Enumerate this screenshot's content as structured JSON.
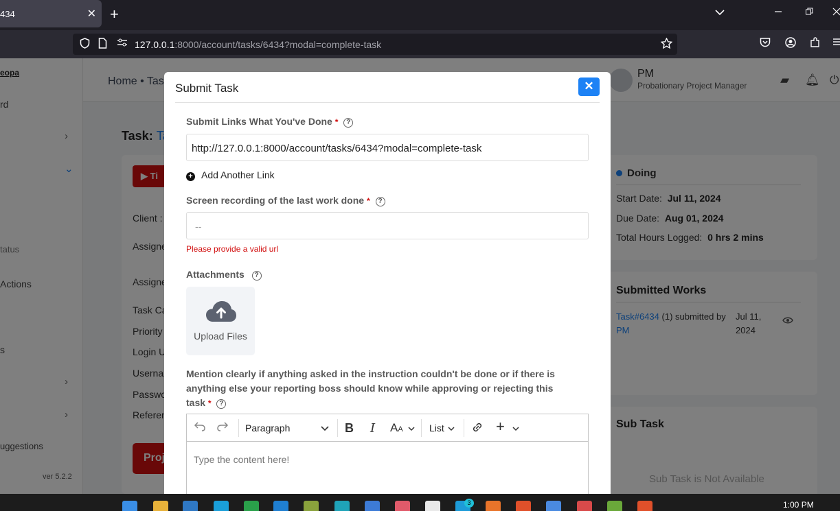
{
  "browser": {
    "tab_title": "434",
    "tab_close": "✕",
    "new_tab": "+",
    "url_host": "127.0.0.1",
    "url_rest": ":8000/account/tasks/6434?modal=complete-task"
  },
  "page": {
    "logo": "eopa",
    "sidebar": {
      "items": [
        {
          "label": "rd"
        },
        {
          "label": "tatus"
        },
        {
          "label": "Actions"
        },
        {
          "label": "s"
        },
        {
          "label": "uggestions"
        }
      ],
      "version": "ver 5.2.2"
    },
    "header": {
      "breadcrumb": "Home • Tas",
      "user_name": "PM",
      "user_role": "Probationary Project Manager"
    },
    "task_heading": {
      "label": "Task:",
      "link": "Ta"
    },
    "left_card": {
      "timer_label": "Ti",
      "fields": [
        "Client :",
        "Assigne",
        "Assigne",
        "Task Ca",
        "Priority",
        "Login U",
        "Userna",
        "Passwo",
        "Referen"
      ],
      "project_button": "Proj"
    },
    "status_card": {
      "status": "Doing",
      "start_label": "Start Date:",
      "start_value": "Jul 11, 2024",
      "due_label": "Due Date:",
      "due_value": "Aug 01, 2024",
      "hours_label": "Total Hours Logged:",
      "hours_value": "0 hrs 2 mins"
    },
    "submitted_card": {
      "title": "Submitted Works",
      "task_link": "Task#6434",
      "count_text": "(1) submitted by",
      "by_link": "PM",
      "date_line1": "Jul 11,",
      "date_line2": "2024"
    },
    "subtask_card": {
      "title": "Sub Task",
      "empty_text": "Sub Task is Not Available"
    }
  },
  "modal": {
    "title": "Submit Task",
    "close": "✕",
    "links_label": "Submit Links What You've Done",
    "links_value": "http://127.0.0.1:8000/account/tasks/6434?modal=complete-task",
    "add_link": "Add Another Link",
    "recording_label": "Screen recording of the last work done",
    "recording_placeholder": "--",
    "recording_error": "Please provide a valid url",
    "attachments_label": "Attachments",
    "upload_label": "Upload Files",
    "mention_label": "Mention clearly if anything asked in the instruction couldn't be done or if there is anything else your reporting boss should know while approving or rejecting this task",
    "required_mark": "*",
    "help_mark": "?",
    "editor": {
      "paragraph": "Paragraph",
      "list": "List",
      "placeholder": "Type the content here!"
    }
  },
  "taskbar": {
    "clock": "1:00 PM",
    "badge": "3"
  }
}
